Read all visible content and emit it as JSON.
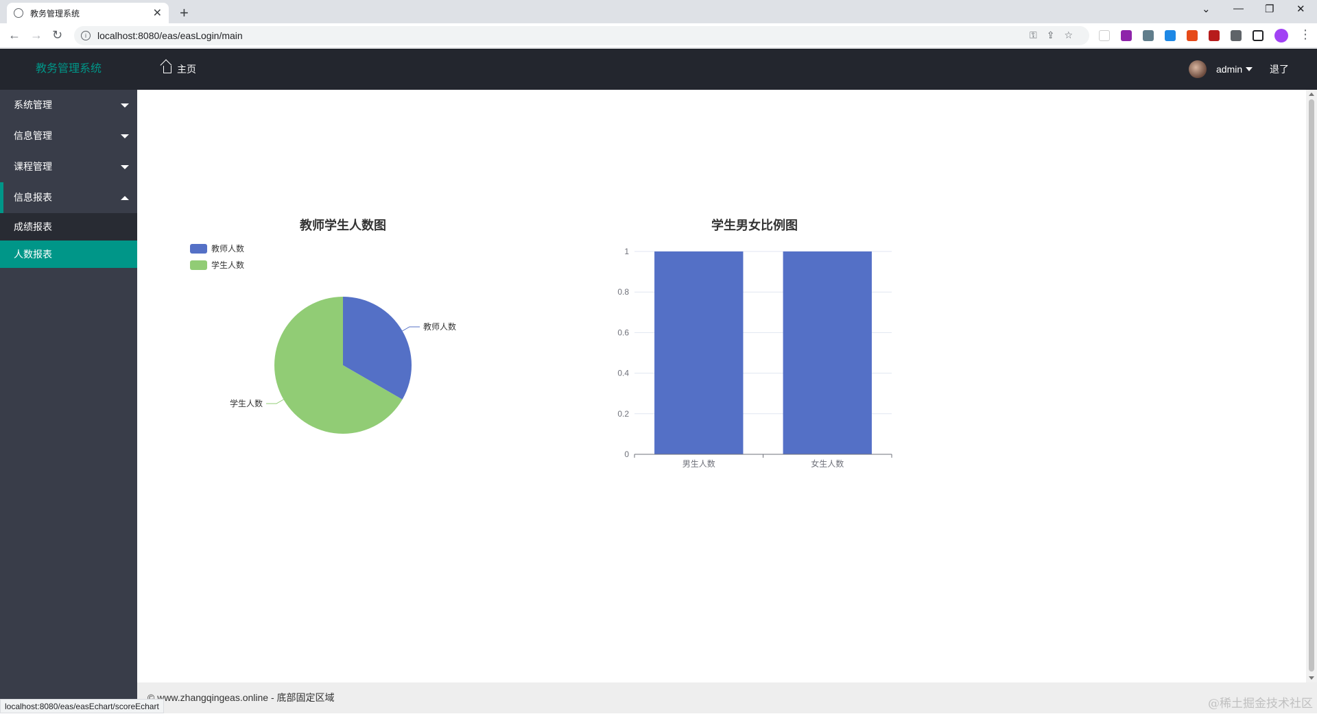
{
  "browser": {
    "tab_title": "教务管理系统",
    "url": "localhost:8080/eas/easLogin/main",
    "status_url": "localhost:8080/eas/easEchart/scoreEchart"
  },
  "header": {
    "logo": "教务管理系统",
    "home_label": "主页",
    "user_name": "admin",
    "logout_label": "退了"
  },
  "sidebar": {
    "items": [
      {
        "label": "系统管理"
      },
      {
        "label": "信息管理"
      },
      {
        "label": "课程管理"
      },
      {
        "label": "信息报表"
      }
    ],
    "sub_items": [
      {
        "label": "成绩报表"
      },
      {
        "label": "人数报表"
      }
    ]
  },
  "footer": {
    "text": "© www.zhangqingeas.online - 底部固定区域",
    "watermark": "@稀土掘金技术社区"
  },
  "chart_data": [
    {
      "type": "pie",
      "title": "教师学生人数图",
      "legend": [
        "教师人数",
        "学生人数"
      ],
      "legend_position": "top-left",
      "labels": [
        "教师人数",
        "学生人数"
      ],
      "values": [
        1,
        2
      ],
      "colors": [
        "#5470c6",
        "#91cc75"
      ]
    },
    {
      "type": "bar",
      "title": "学生男女比例图",
      "categories": [
        "男生人数",
        "女生人数"
      ],
      "values": [
        1,
        1
      ],
      "ylim": [
        0,
        1
      ],
      "yticks": [
        "0",
        "0.2",
        "0.4",
        "0.6",
        "0.8",
        "1"
      ],
      "grid": true,
      "color": "#5470c6"
    }
  ]
}
